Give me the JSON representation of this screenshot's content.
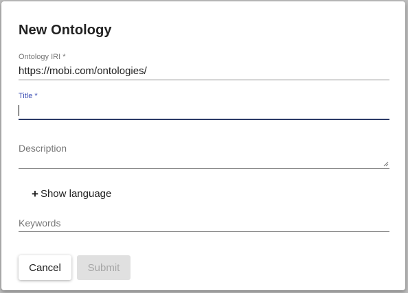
{
  "dialog": {
    "title": "New Ontology",
    "fields": {
      "iri": {
        "label": "Ontology IRI *",
        "value": "https://mobi.com/ontologies/"
      },
      "title": {
        "label": "Title *",
        "value": ""
      },
      "description": {
        "label": "Description"
      },
      "keywords": {
        "label": "Keywords"
      }
    },
    "show_language": {
      "icon": "plus-icon",
      "label": "Show language"
    },
    "buttons": {
      "cancel": "Cancel",
      "submit": "Submit"
    }
  },
  "colors": {
    "focused_label": "#3f51b5",
    "focused_underline": "#2b3a67",
    "disabled_button_bg": "#e0e0e0",
    "disabled_button_text": "#a6a6a6"
  }
}
